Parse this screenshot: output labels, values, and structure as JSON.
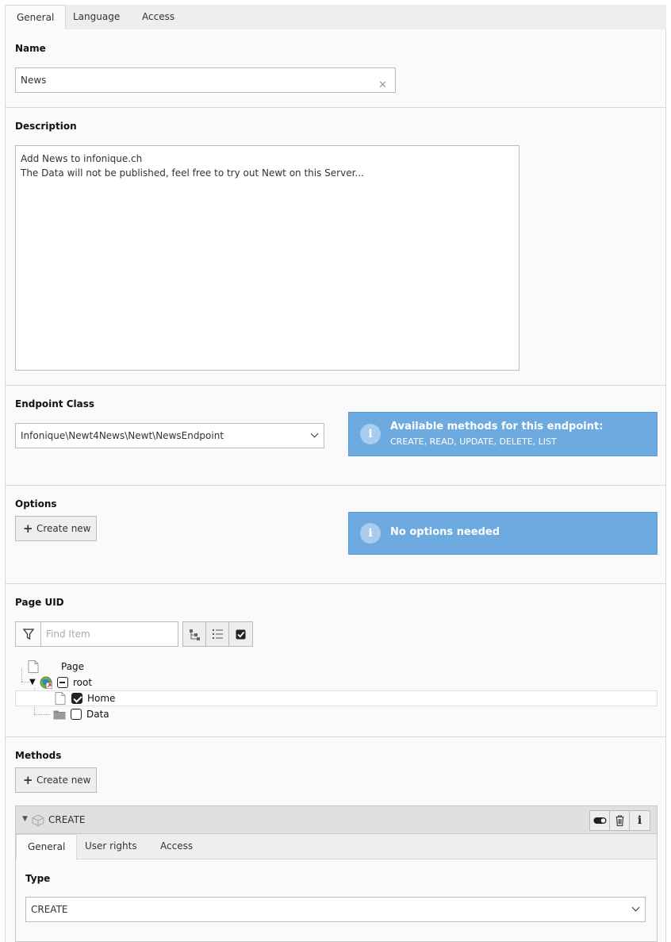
{
  "tabs": [
    {
      "label": "General",
      "active": true
    },
    {
      "label": "Language",
      "active": false
    },
    {
      "label": "Access",
      "active": false
    }
  ],
  "name": {
    "label": "Name",
    "value": "News",
    "clear_icon": "close-icon"
  },
  "description": {
    "label": "Description",
    "lines": [
      "Add News to infonique.ch",
      "The Data will not be published, feel free to try out Newt on this Server..."
    ]
  },
  "endpoint": {
    "label": "Endpoint Class",
    "selected": "Infonique\\Newt4News\\Newt\\NewsEndpoint",
    "info_title": "Available methods for this endpoint:",
    "info_text": "CREATE, READ, UPDATE, DELETE, LIST",
    "info_icon": "info-icon"
  },
  "options": {
    "label": "Options",
    "create_label": "Create new",
    "info_title": "No options needed"
  },
  "page_uid": {
    "label": "Page UID",
    "filter_placeholder": "Find Item",
    "tree": {
      "header": "Page",
      "root": "root",
      "children": [
        {
          "label": "Home",
          "checked": true
        },
        {
          "label": "Data",
          "checked": false
        }
      ]
    }
  },
  "methods": {
    "label": "Methods",
    "create_label": "Create new",
    "record": {
      "title": "CREATE",
      "tabs": [
        {
          "label": "General",
          "active": true
        },
        {
          "label": "User rights",
          "active": false
        },
        {
          "label": "Access",
          "active": false
        }
      ],
      "type_label": "Type",
      "type_value": "CREATE"
    }
  },
  "colors": {
    "info_bg": "#6daae0",
    "panel_bg": "#fafafa",
    "tab_bg": "#eeeeee"
  }
}
